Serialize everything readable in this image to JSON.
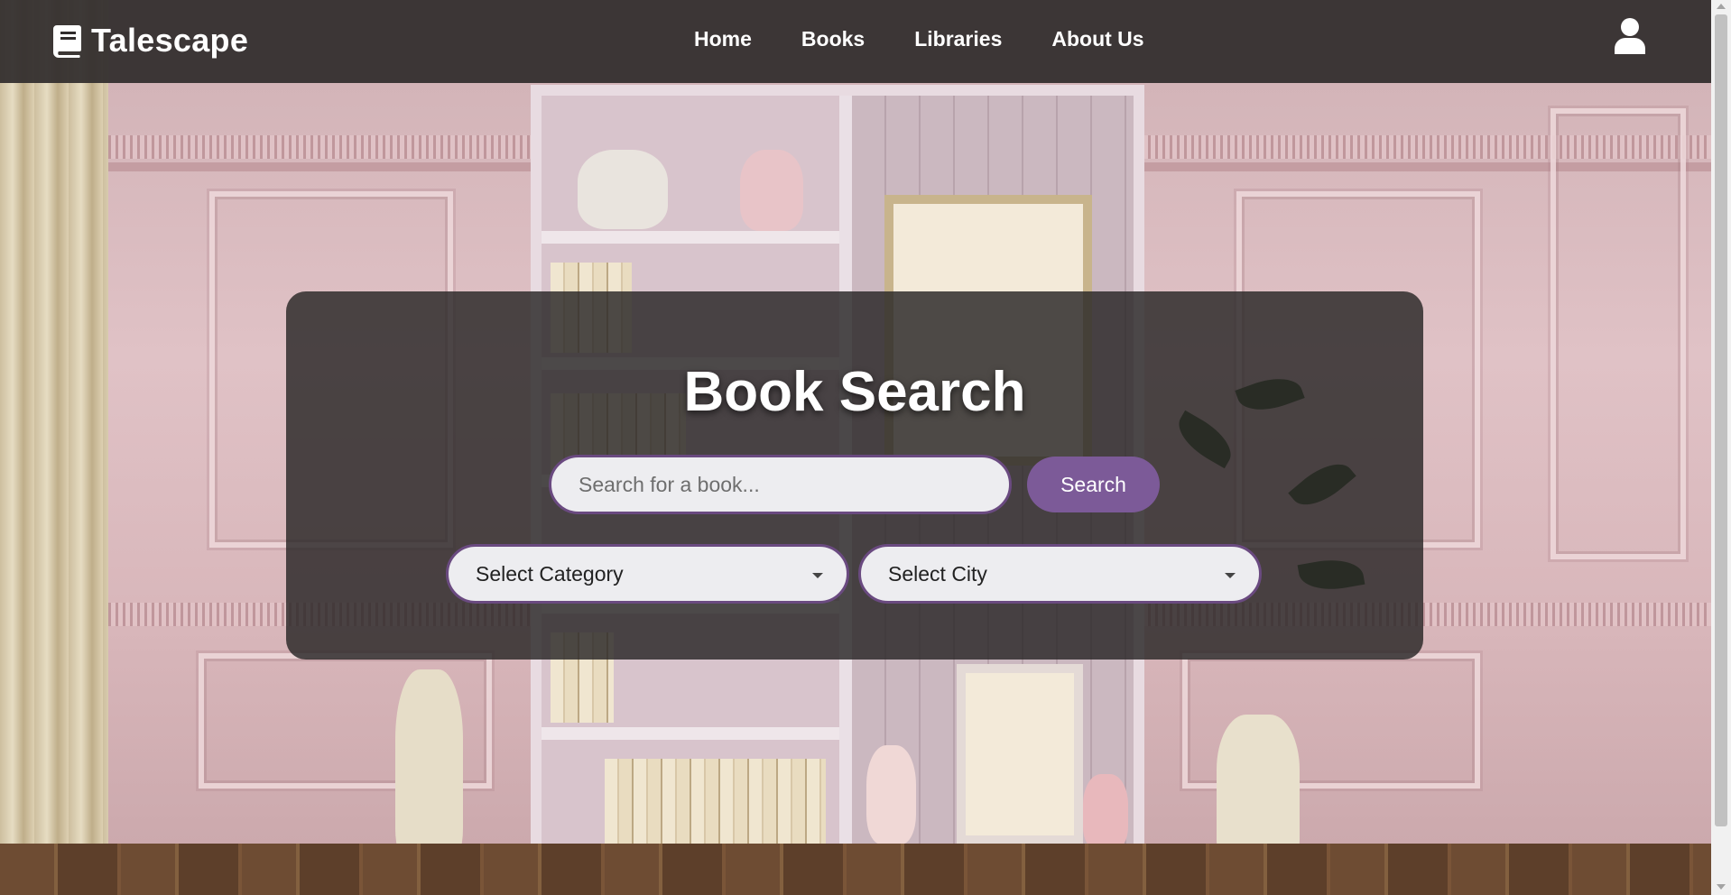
{
  "header": {
    "brand": "Talescape",
    "logo_icon": "book-icon",
    "nav": {
      "home": "Home",
      "books": "Books",
      "libraries": "Libraries",
      "about": "About Us"
    },
    "user_icon": "user-icon"
  },
  "search": {
    "title": "Book Search",
    "placeholder": "Search for a book...",
    "value": "",
    "button_label": "Search",
    "category_select": "Select Category",
    "city_select": "Select City"
  },
  "colors": {
    "header_bg": "#302c2c",
    "accent": "#7c5a98",
    "field_border": "#6a4a80",
    "field_bg": "#ededf0"
  }
}
